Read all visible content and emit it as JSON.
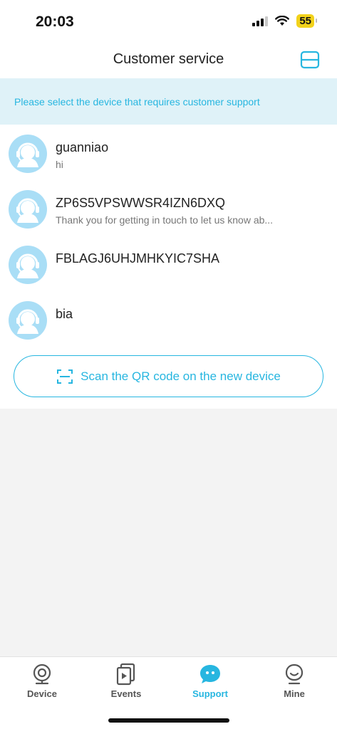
{
  "status_bar": {
    "time": "20:03",
    "battery": "55"
  },
  "header": {
    "title": "Customer service",
    "action_icon": "scan-frame-icon"
  },
  "banner": {
    "text": "Please select the device that requires customer support"
  },
  "devices": [
    {
      "name": "guanniao",
      "last_message": "hi"
    },
    {
      "name": "ZP6S5VPSWWSR4IZN6DXQ",
      "last_message": "Thank you for getting in touch to let us know ab..."
    },
    {
      "name": "FBLAGJ6UHJMHKYIC7SHA",
      "last_message": ""
    },
    {
      "name": "bia",
      "last_message": ""
    }
  ],
  "scan_button": {
    "label": "Scan the QR code on the new device",
    "icon": "qr-scan-icon"
  },
  "tabs": [
    {
      "label": "Device",
      "icon": "camera-icon",
      "active": false
    },
    {
      "label": "Events",
      "icon": "video-file-icon",
      "active": false
    },
    {
      "label": "Support",
      "icon": "chat-bubble-icon",
      "active": true
    },
    {
      "label": "Mine",
      "icon": "profile-face-icon",
      "active": false
    }
  ],
  "colors": {
    "accent": "#27b6e0",
    "banner_bg": "#dff2f8",
    "avatar_bg": "#a9def6",
    "page_bg": "#f3f3f3"
  }
}
